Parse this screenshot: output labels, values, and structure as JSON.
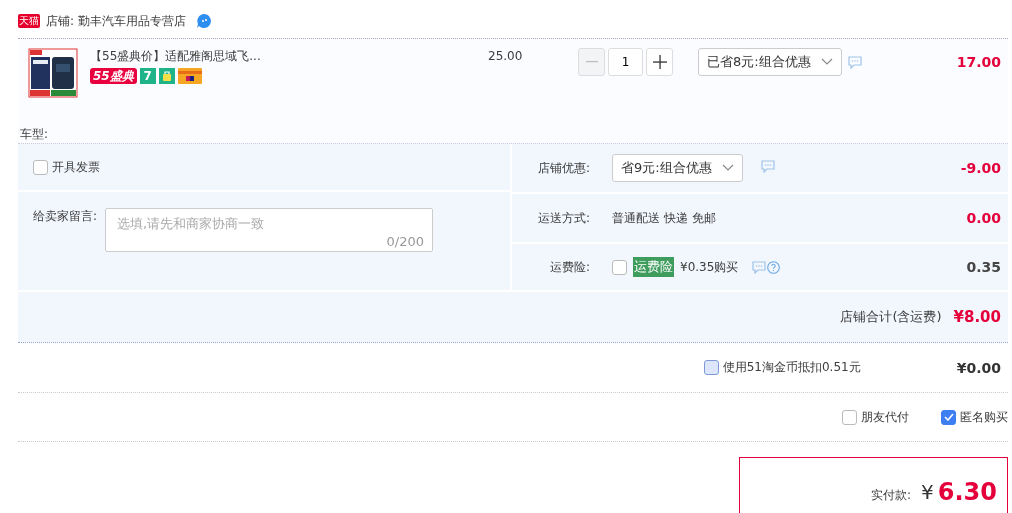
{
  "shop": {
    "badge": "天猫",
    "label": "店铺: 勤丰汽车用品专营店"
  },
  "item": {
    "title": "【55盛典价】适配雅阁思域飞...",
    "promo_badge": "55盛典",
    "service_badges": [
      {
        "kind": "seven",
        "text": "7"
      },
      {
        "kind": "bag"
      },
      {
        "kind": "card"
      }
    ],
    "price": "25.00",
    "quantity": "1",
    "discount": "已省8元:组合优惠",
    "total": "17.00",
    "car_model_label": "车型:"
  },
  "invoice": {
    "label": "开具发票",
    "checked": false
  },
  "message": {
    "label": "给卖家留言:",
    "placeholder": "选填,请先和商家协商一致",
    "counter": "0/200"
  },
  "summary_rows": [
    {
      "kind": "select",
      "label": "店铺优惠:",
      "value": "省9元:组合优惠",
      "amount": "-9.00",
      "highlight": true
    },
    {
      "kind": "text",
      "label": "运送方式:",
      "value": "普通配送 快递 免邮",
      "amount": "0.00",
      "highlight": true
    },
    {
      "kind": "insurance",
      "label": "运费险:",
      "checked": false,
      "tag": "运费险",
      "value": "¥0.35购买",
      "amount": "0.35",
      "highlight": false
    }
  ],
  "shop_total": {
    "label": "店铺合计(含运费)",
    "amount": "¥8.00"
  },
  "coins": {
    "label": "使用51淘金币抵扣0.51元",
    "checked": false,
    "amount": "¥0.00"
  },
  "options": [
    {
      "label": "朋友代付",
      "checked": false
    },
    {
      "label": "匿名购买",
      "checked": true
    }
  ],
  "payment": {
    "label": "实付款:",
    "currency": "¥",
    "amount": "6.30"
  }
}
